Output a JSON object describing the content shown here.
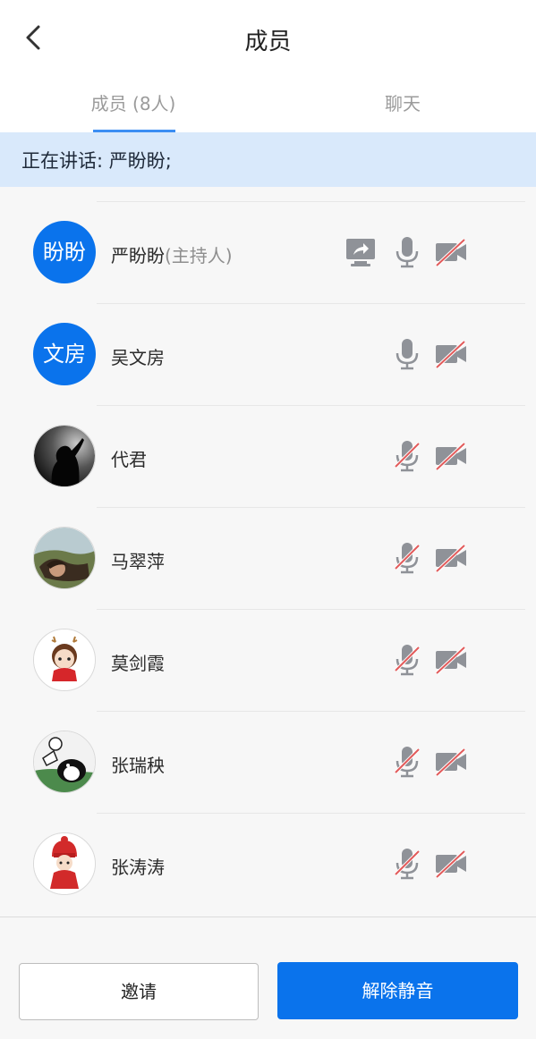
{
  "header": {
    "title": "成员"
  },
  "tabs": [
    {
      "label": "成员 (8人)",
      "active": true
    },
    {
      "label": "聊天",
      "active": false
    }
  ],
  "speaking": {
    "text": "正在讲话: 严盼盼;"
  },
  "members": [
    {
      "name": "严盼盼",
      "role": "(主持人)",
      "avatar_text": "盼盼",
      "sharing": true,
      "mic_muted": false,
      "camera_off": true
    },
    {
      "name": "吴文房",
      "role": "",
      "avatar_text": "文房",
      "sharing": false,
      "mic_muted": false,
      "camera_off": true
    },
    {
      "name": "代君",
      "role": "",
      "avatar_text": "",
      "sharing": false,
      "mic_muted": true,
      "camera_off": true
    },
    {
      "name": "马翠萍",
      "role": "",
      "avatar_text": "",
      "sharing": false,
      "mic_muted": true,
      "camera_off": true
    },
    {
      "name": "莫剑霞",
      "role": "",
      "avatar_text": "",
      "sharing": false,
      "mic_muted": true,
      "camera_off": true
    },
    {
      "name": "张瑞秧",
      "role": "",
      "avatar_text": "",
      "sharing": false,
      "mic_muted": true,
      "camera_off": true
    },
    {
      "name": "张涛涛",
      "role": "",
      "avatar_text": "",
      "sharing": false,
      "mic_muted": true,
      "camera_off": true
    }
  ],
  "footer": {
    "invite_label": "邀请",
    "unmute_label": "解除静音"
  },
  "colors": {
    "accent": "#0a73ec",
    "speaking_bg": "#d9e9fb",
    "muted_red": "#e25b5b",
    "icon_gray": "#8f9298"
  }
}
